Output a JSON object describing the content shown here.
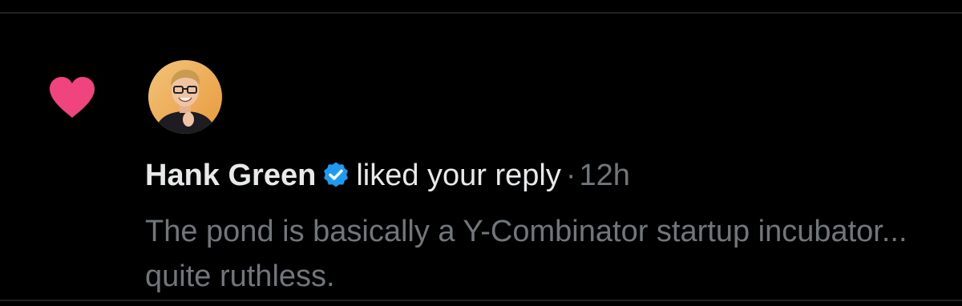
{
  "notification": {
    "type_icon": "heart-icon",
    "author": {
      "name": "Hank Green",
      "verified": true,
      "verified_icon": "verified-badge-icon"
    },
    "action": "liked your reply",
    "separator": "·",
    "timestamp": "12h",
    "reply_text": "The pond is basically a Y-Combinator startup incubator... quite ruthless."
  },
  "colors": {
    "background": "#000000",
    "heart": "#f0447f",
    "verified": "#1d9bf0",
    "primary_text": "#e7e9ea",
    "secondary_text": "#71767b",
    "divider": "#1f2326"
  }
}
